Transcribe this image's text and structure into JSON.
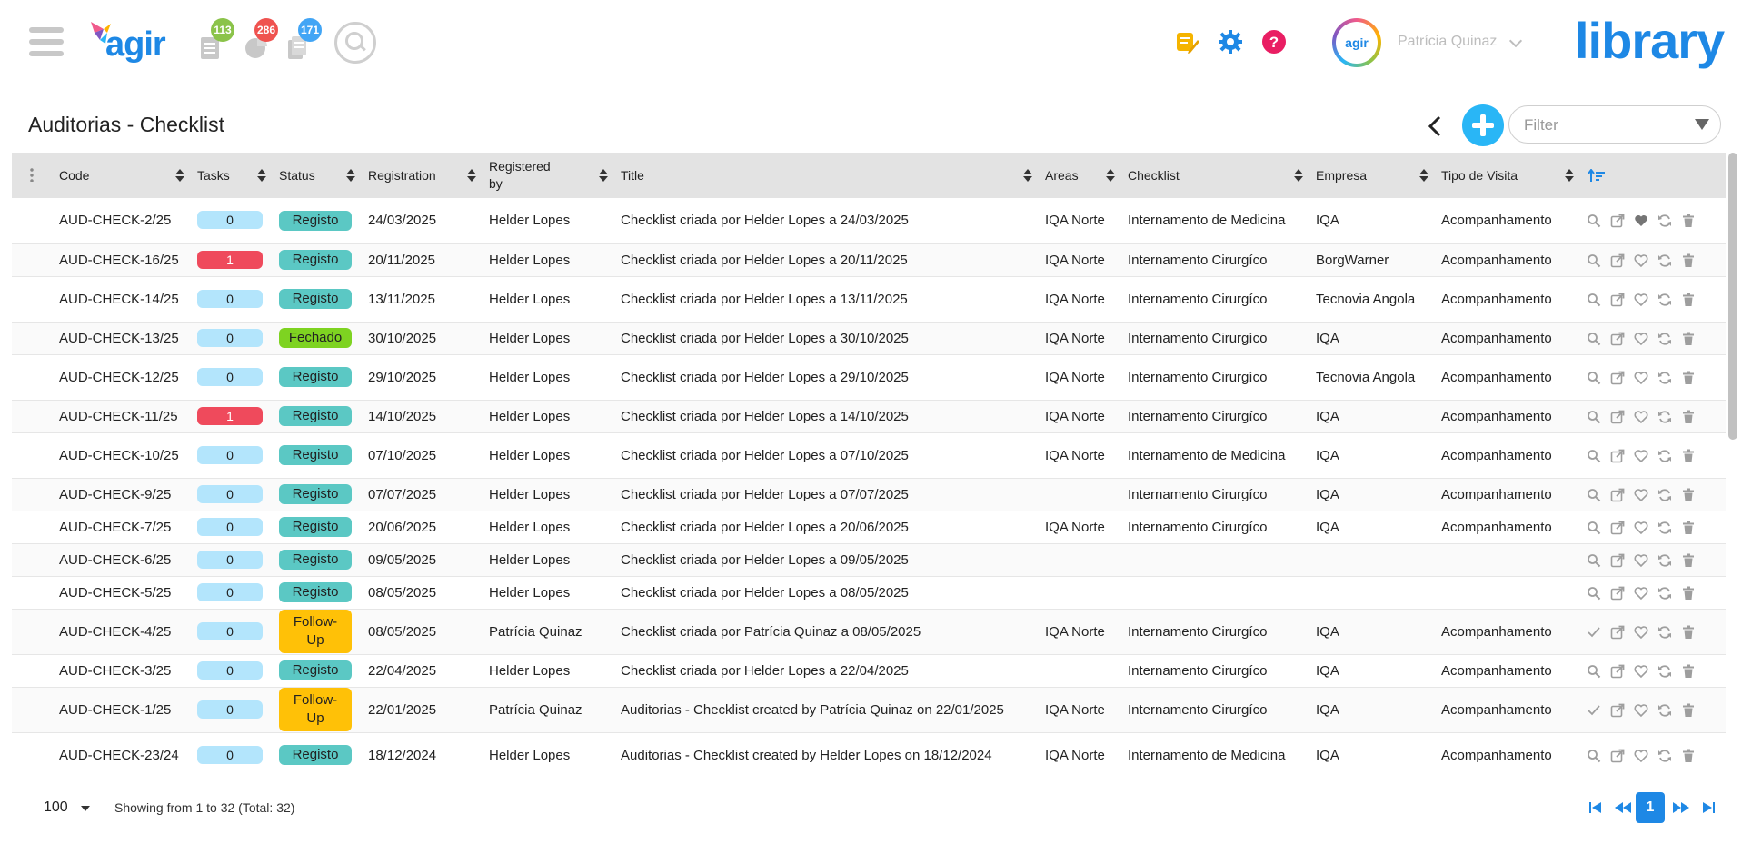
{
  "header": {
    "logo_text": "agir",
    "notifications": [
      {
        "name": "tasks",
        "count": "113",
        "color": "#8bc34a"
      },
      {
        "name": "occurrences",
        "count": "286",
        "color": "#ef5350"
      },
      {
        "name": "documents",
        "count": "171",
        "color": "#42a5f5"
      }
    ],
    "avatar_text": "agir",
    "user_name": "Patrícia Quinaz",
    "brand": "library"
  },
  "page": {
    "title": "Auditorias - Checklist",
    "filter_placeholder": "Filter"
  },
  "table": {
    "columns": [
      "Code",
      "Tasks",
      "Status",
      "Registration",
      "Registered by",
      "Title",
      "Areas",
      "Checklist",
      "Empresa",
      "Tipo de Visita"
    ],
    "rows": [
      {
        "code": "AUD-CHECK-2/25",
        "tasks": "0",
        "status": "Registo",
        "date": "24/03/2025",
        "by": "Helder Lopes",
        "title": "Checklist criada por Helder Lopes a 24/03/2025",
        "area": "IQA Norte",
        "checklist": "Internamento de Medicina",
        "empresa": "IQA",
        "tipo": "Acompanhamento",
        "favorite": true,
        "first_action": "search"
      },
      {
        "code": "AUD-CHECK-16/25",
        "tasks": "1",
        "status": "Registo",
        "date": "20/11/2025",
        "by": "Helder Lopes",
        "title": "Checklist criada por Helder Lopes a 20/11/2025",
        "area": "IQA Norte",
        "checklist": "Internamento Cirurgíco",
        "empresa": "BorgWarner",
        "tipo": "Acompanhamento",
        "favorite": false,
        "first_action": "search"
      },
      {
        "code": "AUD-CHECK-14/25",
        "tasks": "0",
        "status": "Registo",
        "date": "13/11/2025",
        "by": "Helder Lopes",
        "title": "Checklist criada por Helder Lopes a 13/11/2025",
        "area": "IQA Norte",
        "checklist": "Internamento Cirurgíco",
        "empresa": "Tecnovia Angola",
        "tipo": "Acompanhamento",
        "favorite": false,
        "first_action": "search"
      },
      {
        "code": "AUD-CHECK-13/25",
        "tasks": "0",
        "status": "Fechado",
        "date": "30/10/2025",
        "by": "Helder Lopes",
        "title": "Checklist criada por Helder Lopes a 30/10/2025",
        "area": "IQA Norte",
        "checklist": "Internamento Cirurgíco",
        "empresa": "IQA",
        "tipo": "Acompanhamento",
        "favorite": false,
        "first_action": "search"
      },
      {
        "code": "AUD-CHECK-12/25",
        "tasks": "0",
        "status": "Registo",
        "date": "29/10/2025",
        "by": "Helder Lopes",
        "title": "Checklist criada por Helder Lopes a 29/10/2025",
        "area": "IQA Norte",
        "checklist": "Internamento Cirurgíco",
        "empresa": "Tecnovia Angola",
        "tipo": "Acompanhamento",
        "favorite": false,
        "first_action": "search"
      },
      {
        "code": "AUD-CHECK-11/25",
        "tasks": "1",
        "status": "Registo",
        "date": "14/10/2025",
        "by": "Helder Lopes",
        "title": "Checklist criada por Helder Lopes a 14/10/2025",
        "area": "IQA Norte",
        "checklist": "Internamento Cirurgíco",
        "empresa": "IQA",
        "tipo": "Acompanhamento",
        "favorite": false,
        "first_action": "search"
      },
      {
        "code": "AUD-CHECK-10/25",
        "tasks": "0",
        "status": "Registo",
        "date": "07/10/2025",
        "by": "Helder Lopes",
        "title": "Checklist criada por Helder Lopes a 07/10/2025",
        "area": "IQA Norte",
        "checklist": "Internamento de Medicina",
        "empresa": "IQA",
        "tipo": "Acompanhamento",
        "favorite": false,
        "first_action": "search"
      },
      {
        "code": "AUD-CHECK-9/25",
        "tasks": "0",
        "status": "Registo",
        "date": "07/07/2025",
        "by": "Helder Lopes",
        "title": "Checklist criada por Helder Lopes a 07/07/2025",
        "area": "",
        "checklist": "Internamento Cirurgíco",
        "empresa": "IQA",
        "tipo": "Acompanhamento",
        "favorite": false,
        "first_action": "search"
      },
      {
        "code": "AUD-CHECK-7/25",
        "tasks": "0",
        "status": "Registo",
        "date": "20/06/2025",
        "by": "Helder Lopes",
        "title": "Checklist criada por Helder Lopes a 20/06/2025",
        "area": "IQA Norte",
        "checklist": "Internamento Cirurgíco",
        "empresa": "IQA",
        "tipo": "Acompanhamento",
        "favorite": false,
        "first_action": "search"
      },
      {
        "code": "AUD-CHECK-6/25",
        "tasks": "0",
        "status": "Registo",
        "date": "09/05/2025",
        "by": "Helder Lopes",
        "title": "Checklist criada por Helder Lopes a 09/05/2025",
        "area": "",
        "checklist": "",
        "empresa": "",
        "tipo": "",
        "favorite": false,
        "first_action": "search"
      },
      {
        "code": "AUD-CHECK-5/25",
        "tasks": "0",
        "status": "Registo",
        "date": "08/05/2025",
        "by": "Helder Lopes",
        "title": "Checklist criada por Helder Lopes a 08/05/2025",
        "area": "",
        "checklist": "",
        "empresa": "",
        "tipo": "",
        "favorite": false,
        "first_action": "search"
      },
      {
        "code": "AUD-CHECK-4/25",
        "tasks": "0",
        "status": "Follow-Up",
        "date": "08/05/2025",
        "by": "Patrícia Quinaz",
        "title": "Checklist criada por Patrícia Quinaz a 08/05/2025",
        "area": "IQA Norte",
        "checklist": "Internamento Cirurgíco",
        "empresa": "IQA",
        "tipo": "Acompanhamento",
        "favorite": false,
        "first_action": "check"
      },
      {
        "code": "AUD-CHECK-3/25",
        "tasks": "0",
        "status": "Registo",
        "date": "22/04/2025",
        "by": "Helder Lopes",
        "title": "Checklist criada por Helder Lopes a 22/04/2025",
        "area": "",
        "checklist": "Internamento Cirurgíco",
        "empresa": "IQA",
        "tipo": "Acompanhamento",
        "favorite": false,
        "first_action": "search"
      },
      {
        "code": "AUD-CHECK-1/25",
        "tasks": "0",
        "status": "Follow-Up",
        "date": "22/01/2025",
        "by": "Patrícia Quinaz",
        "title": "Auditorias - Checklist created by Patrícia Quinaz on 22/01/2025",
        "area": "IQA Norte",
        "checklist": "Internamento Cirurgíco",
        "empresa": "IQA",
        "tipo": "Acompanhamento",
        "favorite": false,
        "first_action": "check"
      },
      {
        "code": "AUD-CHECK-23/24",
        "tasks": "0",
        "status": "Registo",
        "date": "18/12/2024",
        "by": "Helder Lopes",
        "title": "Auditorias - Checklist created by Helder Lopes on 18/12/2024",
        "area": "IQA Norte",
        "checklist": "Internamento de Medicina",
        "empresa": "IQA",
        "tipo": "Acompanhamento",
        "favorite": false,
        "first_action": "search"
      }
    ]
  },
  "footer": {
    "page_size": "100",
    "showing": "Showing from 1 to 32 (Total: 32)",
    "current_page": "1"
  },
  "colors": {
    "brand": "#1e88e5",
    "status_registo": "#5bc8c4",
    "status_fechado": "#7ed321",
    "status_followup": "#ffc107",
    "tasks_zero": "#b3e5fc",
    "tasks_nonzero": "#ef4a5c"
  }
}
